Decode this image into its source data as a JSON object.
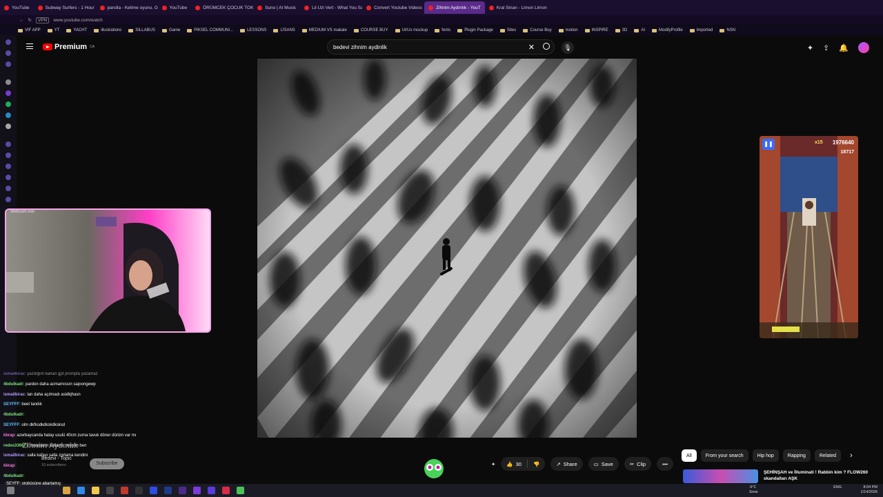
{
  "browser": {
    "tabs": [
      {
        "label": "YouTube",
        "active": false
      },
      {
        "label": "Subway Surfers - 1 Hour",
        "active": false
      },
      {
        "label": "parolla - Kelime oyunu. G",
        "active": false
      },
      {
        "label": "YouTube",
        "active": false
      },
      {
        "label": "ÖRÜMCEK ÇOCUK TOKA",
        "active": false
      },
      {
        "label": "Suno | AI Music",
        "active": false
      },
      {
        "label": "Lil Uzi Vert - What You Sa",
        "active": false
      },
      {
        "label": "Convert Youtube Videos",
        "active": false
      },
      {
        "label": "Zihnim Aydınlık - YouT",
        "active": true
      },
      {
        "label": "Kral Sinan - Limon Limon",
        "active": false
      }
    ],
    "address": "www.youtube.com/watch",
    "vpn_badge": "VPN",
    "bookmarks": [
      "VIF APP",
      "YT",
      "YACHT",
      "illustrations",
      "SILLABUS",
      "Game",
      "PIKSEL COMMUNI...",
      "LESSONS",
      "LİSANS",
      "MEDIUM VS makale",
      "COURSE BUY",
      "UI/Ux mockup",
      "fonts",
      "Plugin Package",
      "Sites",
      "Course Buy",
      "motion",
      "INSPIRE",
      "3D",
      "AI",
      "ModifyProfile",
      "Imported",
      "NSN"
    ]
  },
  "youtube": {
    "logo_text": "Premium",
    "logo_region": "CA",
    "search_value": "bedevi zihnim aydinlik",
    "channel_name": "Bedevi - Topic",
    "subscribers": "10 subscribers",
    "subscribe_label": "Subscribe",
    "overlay_title": "Zihnim Aydınlık",
    "like_count": "30",
    "share_label": "Share",
    "save_label": "Save",
    "clip_label": "Clip",
    "chips": [
      "All",
      "From your search",
      "Hip hop",
      "Rapping",
      "Related"
    ],
    "rec_title": "ŞEHİNŞAH ve İlluminati ! Rabbin kim ? FLOW260 skandalları AŞK"
  },
  "webcam": {
    "label": "Webcam.exe"
  },
  "game": {
    "score": "1976640",
    "coins": "18717",
    "multiplier": "x15"
  },
  "chat": [
    {
      "user": "ismailkirac",
      "message": "yazdığım barları gpt prompta yazamaz",
      "color": "u2",
      "faded": true
    },
    {
      "user": "4bdulkadr",
      "message": "pardon daha acmamıssın sapıongewp",
      "color": "u1"
    },
    {
      "user": "ismailkirac",
      "message": "lan daha açılmadı asidkjhasn",
      "color": "u2"
    },
    {
      "user": "SEYFFF",
      "message": "beet tandık",
      "color": "u3"
    },
    {
      "user": "4bdulkadr",
      "message": "",
      "color": "u1"
    },
    {
      "user": "SEYFFF",
      "message": "olm dkfksdkdkskdksksd",
      "color": "u3"
    },
    {
      "user": "kkrap",
      "message": "azerbaycanda hatay usulü 40cm zurna tavuk döner dürüm var mı",
      "color": "u4"
    },
    {
      "user": "redes336677",
      "message": "insanların kollarını neyyim ben",
      "color": "u1"
    },
    {
      "user": "ismailkirac",
      "message": "salla kafayı salla zorlama kendini",
      "color": "u2"
    },
    {
      "user": "kkrap",
      "message": "",
      "color": "u4"
    },
    {
      "user": "4bdulkadr",
      "message": "",
      "color": "u1"
    }
  ],
  "overlay_ticker": "SEYFF: otobüsüne abartamış",
  "tray": {
    "weather_temp": "-6°C",
    "weather_desc": "Snow",
    "lang": "ENG",
    "time": "8:04 PM",
    "date": "1/14/2026"
  }
}
